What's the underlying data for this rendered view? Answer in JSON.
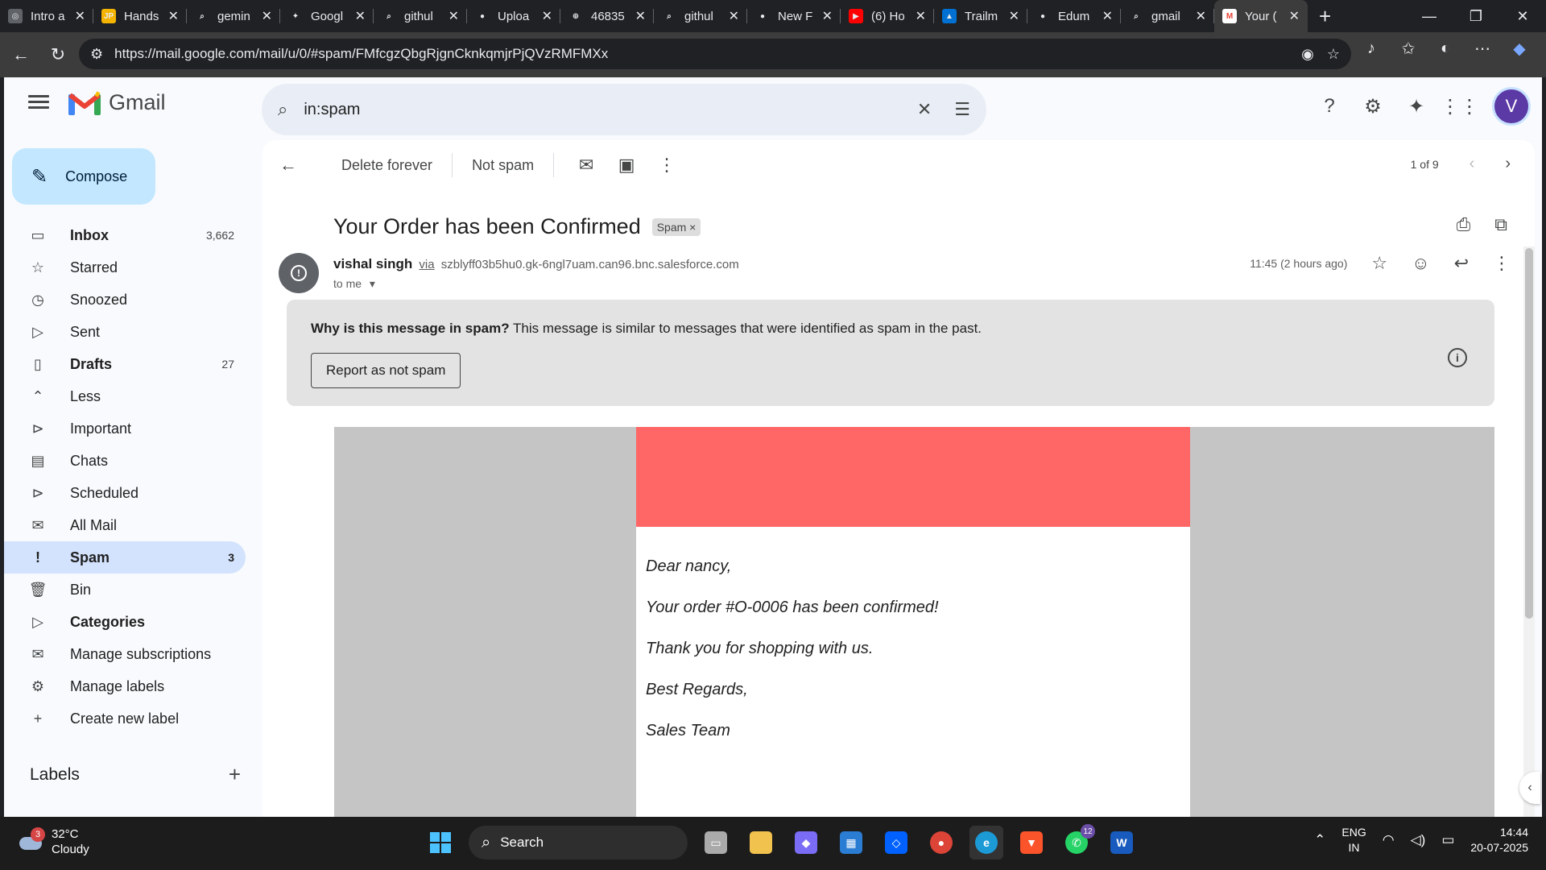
{
  "browser": {
    "tabs": [
      {
        "title": "Intro a",
        "color": "#5f6368",
        "glyph": "◎"
      },
      {
        "title": "Hands",
        "color": "#f4b400",
        "glyph": "JP"
      },
      {
        "title": "gemin",
        "color": "#202124",
        "glyph": "⌕"
      },
      {
        "title": "Googl",
        "color": "#202124",
        "glyph": "✦"
      },
      {
        "title": "githul",
        "color": "#202124",
        "glyph": "⌕"
      },
      {
        "title": "Uploa",
        "color": "#202124",
        "glyph": "●"
      },
      {
        "title": "46835",
        "color": "#202124",
        "glyph": "⊕"
      },
      {
        "title": "githul",
        "color": "#202124",
        "glyph": "⌕"
      },
      {
        "title": "New F",
        "color": "#202124",
        "glyph": "●"
      },
      {
        "title": "(6) Ho",
        "color": "#ff0000",
        "glyph": "▶"
      },
      {
        "title": "Trailm",
        "color": "#0070d2",
        "glyph": "▲"
      },
      {
        "title": "Edum",
        "color": "#202124",
        "glyph": "●"
      },
      {
        "title": "gmail",
        "color": "#202124",
        "glyph": "⌕"
      },
      {
        "title": "Your (",
        "color": "#ffffff",
        "glyph": "M",
        "active": true
      }
    ],
    "url": "https://mail.google.com/mail/u/0/#spam/FMfcgzQbgRjgnCknkqmjrPjQVzRMFMXx"
  },
  "gmail": {
    "brand": "Gmail",
    "search_query": "in:spam",
    "compose_label": "Compose",
    "nav": [
      {
        "label": "Inbox",
        "count": "3,662",
        "icon": "inbox-icon",
        "glyph": "▭",
        "bold": true
      },
      {
        "label": "Starred",
        "count": "",
        "icon": "star-icon",
        "glyph": "☆"
      },
      {
        "label": "Snoozed",
        "count": "",
        "icon": "clock-icon",
        "glyph": "◷"
      },
      {
        "label": "Sent",
        "count": "",
        "icon": "send-icon",
        "glyph": "▷"
      },
      {
        "label": "Drafts",
        "count": "27",
        "icon": "draft-icon",
        "glyph": "▯",
        "bold": true
      },
      {
        "label": "Less",
        "count": "",
        "icon": "chevron-up-icon",
        "glyph": "⌃"
      },
      {
        "label": "Important",
        "count": "",
        "icon": "important-icon",
        "glyph": "⊳"
      },
      {
        "label": "Chats",
        "count": "",
        "icon": "chat-icon",
        "glyph": "▤"
      },
      {
        "label": "Scheduled",
        "count": "",
        "icon": "scheduled-icon",
        "glyph": "⊳"
      },
      {
        "label": "All Mail",
        "count": "",
        "icon": "all-mail-icon",
        "glyph": "✉"
      },
      {
        "label": "Spam",
        "count": "3",
        "icon": "spam-icon",
        "glyph": "!",
        "active": true
      },
      {
        "label": "Bin",
        "count": "",
        "icon": "bin-icon",
        "glyph": "🗑"
      },
      {
        "label": "Categories",
        "count": "",
        "icon": "label-icon",
        "glyph": "▷",
        "bold": true
      },
      {
        "label": "Manage subscriptions",
        "count": "",
        "icon": "subscriptions-icon",
        "glyph": "✉"
      },
      {
        "label": "Manage labels",
        "count": "",
        "icon": "gear-icon",
        "glyph": "⚙"
      },
      {
        "label": "Create new label",
        "count": "",
        "icon": "plus-icon",
        "glyph": "+"
      }
    ],
    "labels_header": "Labels",
    "toolbar": {
      "delete_forever": "Delete forever",
      "not_spam": "Not spam",
      "pager": "1 of 9"
    },
    "message": {
      "subject": "Your Order has been Confirmed",
      "chip": "Spam",
      "sender_name": "vishal singh",
      "via": "via",
      "sender_domain": "szblyff03b5hu0.gk-6ngl7uam.can96.bnc.salesforce.com",
      "to": "to me",
      "time": "11:45 (2 hours ago)"
    },
    "spam_banner": {
      "why_bold": "Why is this message in spam?",
      "why_text": "This message is similar to messages that were identified as spam in the past.",
      "report_button": "Report as not spam"
    },
    "email": {
      "banner_color": "#ff6666",
      "lines": [
        "Dear nancy,",
        "Your order #O-0006 has been confirmed!",
        "Thank you for shopping with us.",
        "Best Regards,",
        "Sales Team"
      ]
    }
  },
  "taskbar": {
    "weather_badge": "3",
    "temperature": "32°C",
    "condition": "Cloudy",
    "search_label": "Search",
    "whatsapp_badge": "12",
    "lang_top": "ENG",
    "lang_bottom": "IN",
    "time": "14:44",
    "date": "20-07-2025"
  }
}
